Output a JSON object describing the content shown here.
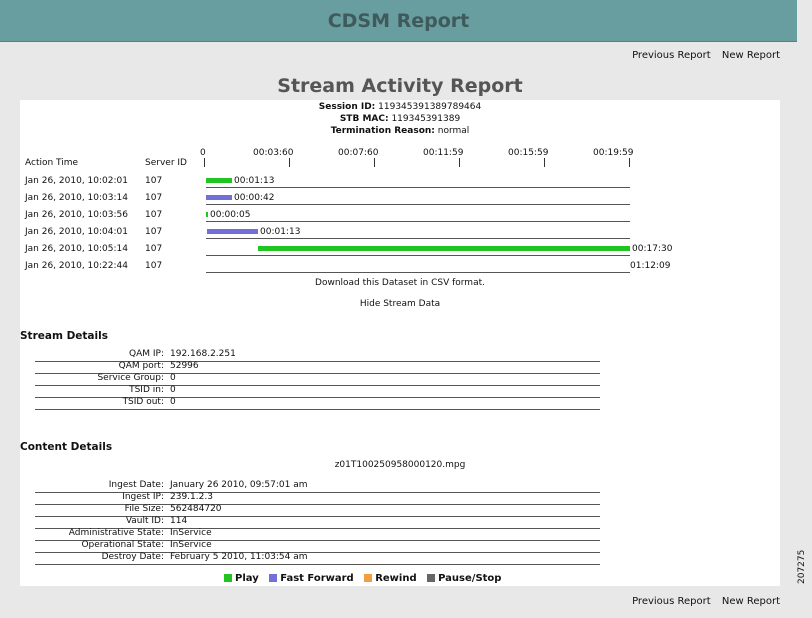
{
  "header": {
    "title": "CDSM Report"
  },
  "nav": {
    "previous": "Previous Report",
    "new": "New Report"
  },
  "report": {
    "title": "Stream Activity Report",
    "session_label": "Session ID:",
    "session_value": "119345391389789464",
    "stb_label": "STB MAC:",
    "stb_value": "119345391389",
    "termination_label": "Termination Reason:",
    "termination_value": "normal"
  },
  "timeline": {
    "col_action_time": "Action Time",
    "col_server_id": "Server ID",
    "ticks": [
      "0",
      "00:03:60",
      "00:07:60",
      "00:11:59",
      "00:15:59",
      "00:19:59"
    ],
    "rows": [
      {
        "time": "Jan 26, 2010, 10:02:01",
        "server": "107",
        "duration": "00:01:13",
        "type": "play"
      },
      {
        "time": "Jan 26, 2010, 10:03:14",
        "server": "107",
        "duration": "00:00:42",
        "type": "ff"
      },
      {
        "time": "Jan 26, 2010, 10:03:56",
        "server": "107",
        "duration": "00:00:05",
        "type": "play"
      },
      {
        "time": "Jan 26, 2010, 10:04:01",
        "server": "107",
        "duration": "00:01:13",
        "type": "ff"
      },
      {
        "time": "Jan 26, 2010, 10:05:14",
        "server": "107",
        "duration": "00:17:30",
        "type": "play"
      },
      {
        "time": "Jan 26, 2010, 10:22:44",
        "server": "107",
        "duration": "01:12:09",
        "type": "none"
      }
    ],
    "download_link": "Download this Dataset in CSV format.",
    "hide_link": "Hide Stream Data"
  },
  "stream_details": {
    "title": "Stream Details",
    "fields": [
      {
        "label": "QAM IP:",
        "value": "192.168.2.251"
      },
      {
        "label": "QAM port:",
        "value": "52996"
      },
      {
        "label": "Service Group:",
        "value": "0"
      },
      {
        "label": "TSID in:",
        "value": "0"
      },
      {
        "label": "TSID out:",
        "value": "0"
      }
    ]
  },
  "content_details": {
    "title": "Content Details",
    "filename": "z01T100250958000120.mpg",
    "fields": [
      {
        "label": "Ingest Date:",
        "value": "January 26 2010, 09:57:01 am"
      },
      {
        "label": "Ingest IP:",
        "value": "239.1.2.3"
      },
      {
        "label": "File Size:",
        "value": "562484720"
      },
      {
        "label": "Vault ID:",
        "value": "114"
      },
      {
        "label": "Administrative State:",
        "value": "InService"
      },
      {
        "label": "Operational State:",
        "value": "InService"
      },
      {
        "label": "Destroy Date:",
        "value": "February 5 2010, 11:03:54 am"
      }
    ]
  },
  "legend": [
    {
      "label": "Play",
      "color": "#22c422"
    },
    {
      "label": "Fast Forward",
      "color": "#7070d8"
    },
    {
      "label": "Rewind",
      "color": "#f0a040"
    },
    {
      "label": "Pause/Stop",
      "color": "#666666"
    }
  ],
  "figure_id": "207275"
}
